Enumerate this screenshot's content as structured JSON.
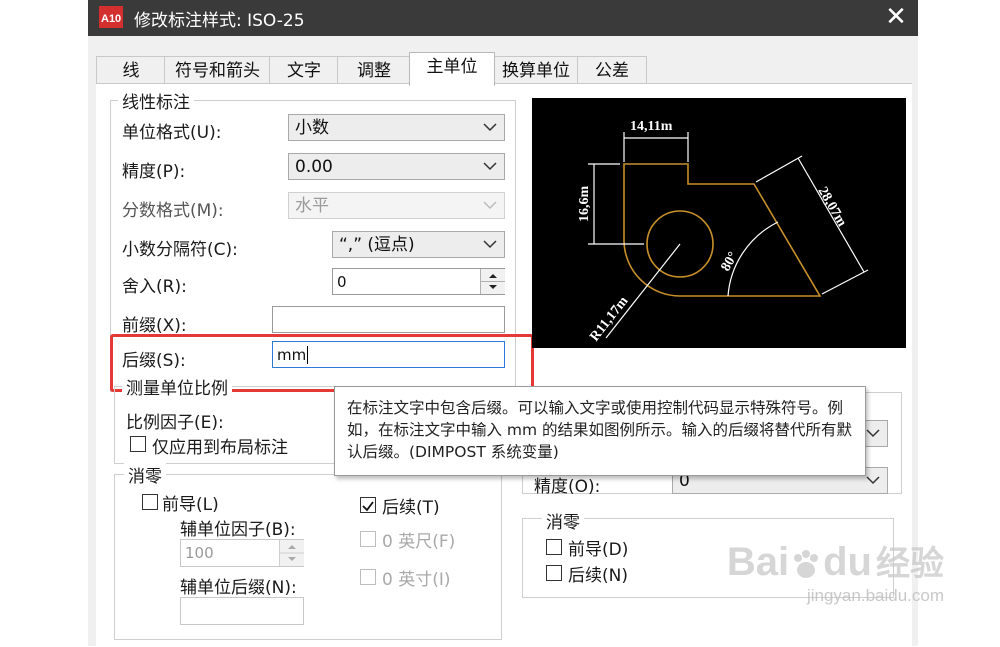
{
  "window": {
    "title": "修改标注样式: ISO-25",
    "close_glyph": "✕",
    "app_icon_text": "A10"
  },
  "tabs": [
    {
      "label": "线"
    },
    {
      "label": "符号和箭头"
    },
    {
      "label": "文字"
    },
    {
      "label": "调整"
    },
    {
      "label": "主单位"
    },
    {
      "label": "换算单位"
    },
    {
      "label": "公差"
    }
  ],
  "linear": {
    "group_title": "线性标注",
    "unit_format_label": "单位格式(U):",
    "unit_format_value": "小数",
    "precision_label": "精度(P):",
    "precision_value": "0.00",
    "fraction_label": "分数格式(M):",
    "fraction_value": "水平",
    "decimal_sep_label": "小数分隔符(C):",
    "decimal_sep_value": "“,” (逗点)",
    "round_label": "舍入(R):",
    "round_value": "0",
    "prefix_label": "前缀(X):",
    "prefix_value": "",
    "suffix_label": "后缀(S):",
    "suffix_value": "mm"
  },
  "scale": {
    "group_title": "测量单位比例",
    "factor_label": "比例因子(E):",
    "layout_only_label": "仅应用到布局标注"
  },
  "zero_supp": {
    "group_title": "消零",
    "leading_label": "前导(L)",
    "trailing_label": "后续(T)",
    "trailing_checked": true,
    "sub_factor_label": "辅单位因子(B):",
    "sub_factor_value": "100",
    "sub_suffix_label": "辅单位后缀(N):",
    "feet_label": "0 英尺(F)",
    "inches_label": "0 英寸(I)"
  },
  "angular": {
    "precision_label": "精度(O):",
    "precision_value": "0",
    "zero_title": "消零",
    "leading_label": "前导(D)",
    "trailing_label": "后续(N)"
  },
  "preview": {
    "dim_top": "14,11m",
    "dim_left": "16,6m",
    "dim_right": "28,07m",
    "dim_angle": "80°",
    "dim_radius": "R11,17m"
  },
  "tooltip": {
    "text": "在标注文字中包含后缀。可以输入文字或使用控制代码显示特殊符号。例如，在标注文字中输入 mm 的结果如图例所示。输入的后缀将替代所有默认后缀。(DIMPOST 系统变量)"
  },
  "watermark": {
    "brand": "Bai",
    "brand2": "du",
    "jingyan": "经验",
    "url": "jingyan.baidu.com"
  },
  "colors": {
    "accent": "#2b7bd6",
    "highlight_box": "#e53935",
    "preview_lines": "#c8902a"
  }
}
